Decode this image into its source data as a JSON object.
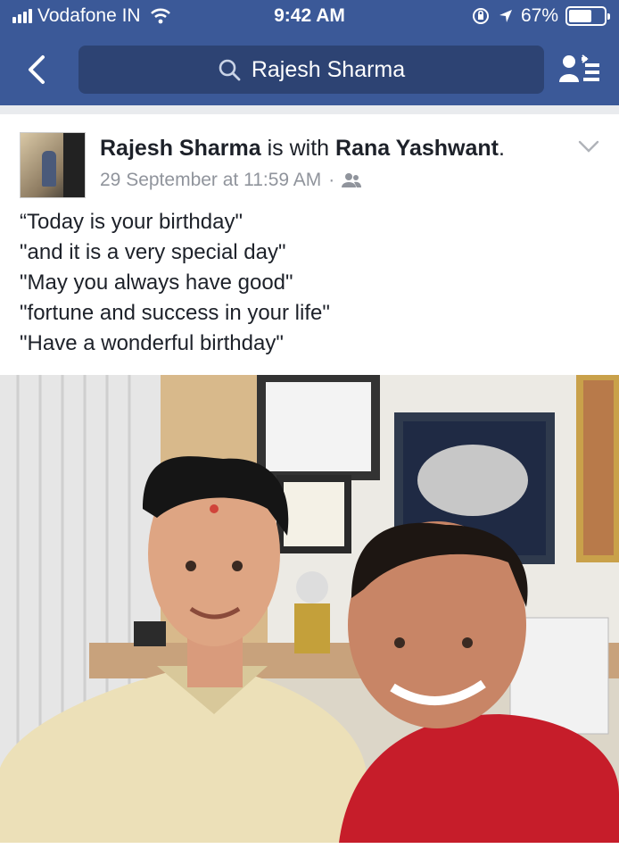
{
  "status_bar": {
    "carrier": "Vodafone IN",
    "time": "9:42 AM",
    "battery_percent": "67%",
    "battery_level": 0.67
  },
  "nav": {
    "search_value": "Rajesh Sharma"
  },
  "post": {
    "author": "Rajesh Sharma",
    "with_text": "is with",
    "tagged": "Rana Yashwant",
    "period": ".",
    "timestamp": "29 September at 11:59 AM",
    "separator": "·",
    "lines": [
      "“Today is your birthday\"",
      "\"and it is a very special day\"",
      "\"May you always have good\"",
      "\"fortune and success in your life\"",
      "\"Have a wonderful birthday\""
    ]
  },
  "colors": {
    "brand": "#3b5998",
    "search_bg": "#2d4373",
    "meta_text": "#90949c"
  },
  "icons": [
    "signal-icon",
    "wifi-icon",
    "orientation-lock-icon",
    "location-icon",
    "battery-icon",
    "back-chevron-icon",
    "search-icon",
    "friends-list-icon",
    "chevron-down-icon",
    "friends-audience-icon"
  ]
}
